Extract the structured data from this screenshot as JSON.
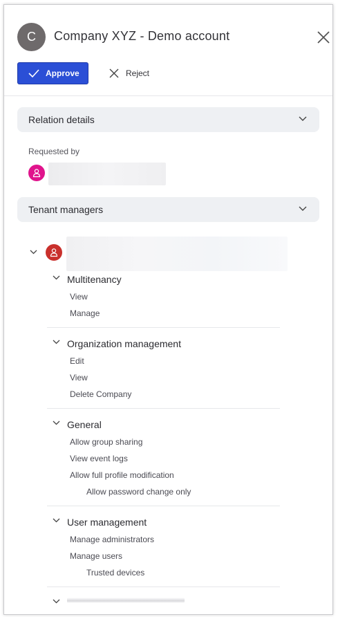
{
  "header": {
    "avatar_letter": "C",
    "title": "Company XYZ - Demo account",
    "approve_label": "Approve",
    "reject_label": "Reject"
  },
  "relation_details": {
    "title": "Relation details",
    "requested_by_label": "Requested by"
  },
  "tenant_managers": {
    "title": "Tenant managers",
    "groups": [
      {
        "title": "Multitenancy",
        "items": [
          "View",
          "Manage"
        ]
      },
      {
        "title": "Organization management",
        "items": [
          "Edit",
          "View",
          "Delete Company"
        ]
      },
      {
        "title": "General",
        "items": [
          "Allow group sharing",
          "View event logs",
          "Allow full profile modification"
        ],
        "sub_items": [
          "Allow password change only"
        ]
      },
      {
        "title": "User management",
        "items": [
          "Manage administrators",
          "Manage users"
        ],
        "sub_items": [
          "Trusted devices"
        ]
      }
    ]
  },
  "colors": {
    "primary": "#2b4fd6",
    "section_bg": "#eef0f3",
    "requester_badge": "#e0148c",
    "manager_badge": "#c9302c"
  }
}
